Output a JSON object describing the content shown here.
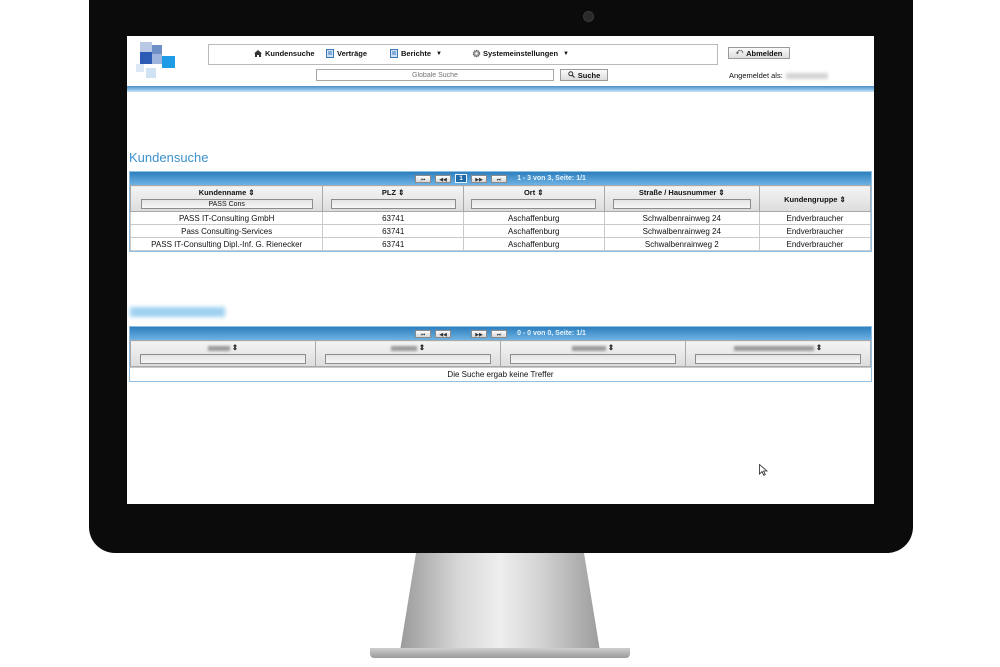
{
  "nav": {
    "items": [
      {
        "label": "Kundensuche",
        "icon": "home-icon",
        "has_menu": false
      },
      {
        "label": "Verträge",
        "icon": "document-icon",
        "has_menu": false
      },
      {
        "label": "Berichte",
        "icon": "report-icon",
        "has_menu": true
      },
      {
        "label": "Systemeinstellungen",
        "icon": "gear-icon",
        "has_menu": true
      }
    ],
    "logout_label": "Abmelden"
  },
  "search": {
    "placeholder": "Globale Suche",
    "button_label": "Suche"
  },
  "user": {
    "logged_in_label": "Angemeldet als:"
  },
  "customer_search": {
    "title": "Kundensuche",
    "pager": {
      "first": "⏮",
      "prev": "◀◀",
      "current_page": "1",
      "next": "▶▶",
      "last": "⏭",
      "info": "1 - 3 von 3, Seite: 1/1"
    },
    "columns": [
      {
        "label": "Kundenname ⇕",
        "filter": "PASS Cons"
      },
      {
        "label": "PLZ ⇕",
        "filter": ""
      },
      {
        "label": "Ort ⇕",
        "filter": ""
      },
      {
        "label": "Straße / Hausnummer ⇕",
        "filter": ""
      },
      {
        "label": "Kundengruppe ⇕"
      }
    ],
    "rows": [
      [
        "PASS IT-Consulting GmbH",
        "63741",
        "Aschaffenburg",
        "Schwalbenrainweg 24",
        "Endverbraucher"
      ],
      [
        "Pass Consulting-Services",
        "63741",
        "Aschaffenburg",
        "Schwalbenrainweg 24",
        "Endverbraucher"
      ],
      [
        "PASS IT-Consulting Dipl.-Inf. G. Rienecker",
        "63741",
        "Aschaffenburg",
        "Schwalbenrainweg 2",
        "Endverbraucher"
      ]
    ]
  },
  "second_grid": {
    "pager": {
      "first": "⏮",
      "prev": "◀◀",
      "next": "▶▶",
      "last": "⏭",
      "info": "0 - 0 von 0, Seite: 1/1"
    },
    "empty_message": "Die Suche ergab keine Treffer"
  },
  "colors": {
    "accent": "#3d92cf",
    "pager_bar": "#2d7fbf",
    "monitor_bezel": "#0b0b0b"
  }
}
